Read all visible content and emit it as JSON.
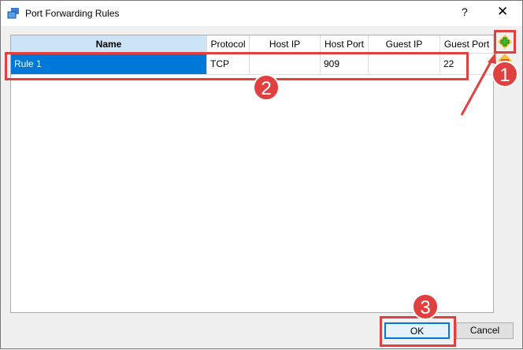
{
  "window": {
    "title": "Port Forwarding Rules",
    "help": "?",
    "close": "✕"
  },
  "table": {
    "columns": [
      "Name",
      "Protocol",
      "Host IP",
      "Host Port",
      "Guest IP",
      "Guest Port"
    ],
    "rows": [
      [
        "Rule 1",
        "TCP",
        "",
        "909",
        "",
        "22"
      ]
    ]
  },
  "side_buttons": {
    "add": "add-rule-icon",
    "remove": "remove-rule-icon"
  },
  "buttons": {
    "ok": "OK",
    "cancel": "Cancel"
  },
  "annotations": [
    "1",
    "2",
    "3"
  ],
  "colors": {
    "selection": "#0078d7",
    "header_selected": "#cce4f7",
    "annotation": "#e0403f"
  }
}
